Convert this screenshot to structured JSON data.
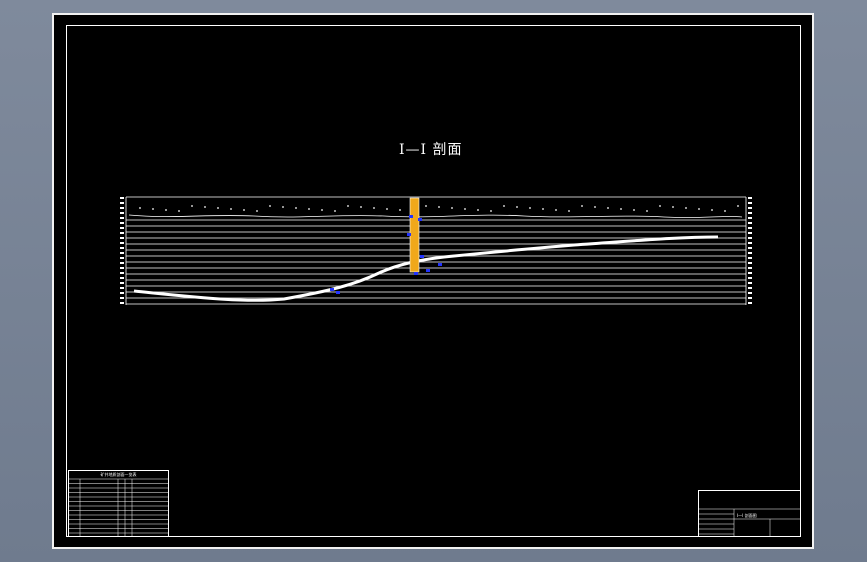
{
  "drawing": {
    "section_title": "I—I 剖面",
    "legend_table": {
      "title": "矿井地质剖面一览表"
    },
    "title_block": {
      "drawing_name": "I—I 剖面图"
    }
  },
  "colors": {
    "background": "#707b8e",
    "sheet": "#000000",
    "line": "#ffffff",
    "shaft": "#f0a81a",
    "marker": "#2233ff"
  }
}
